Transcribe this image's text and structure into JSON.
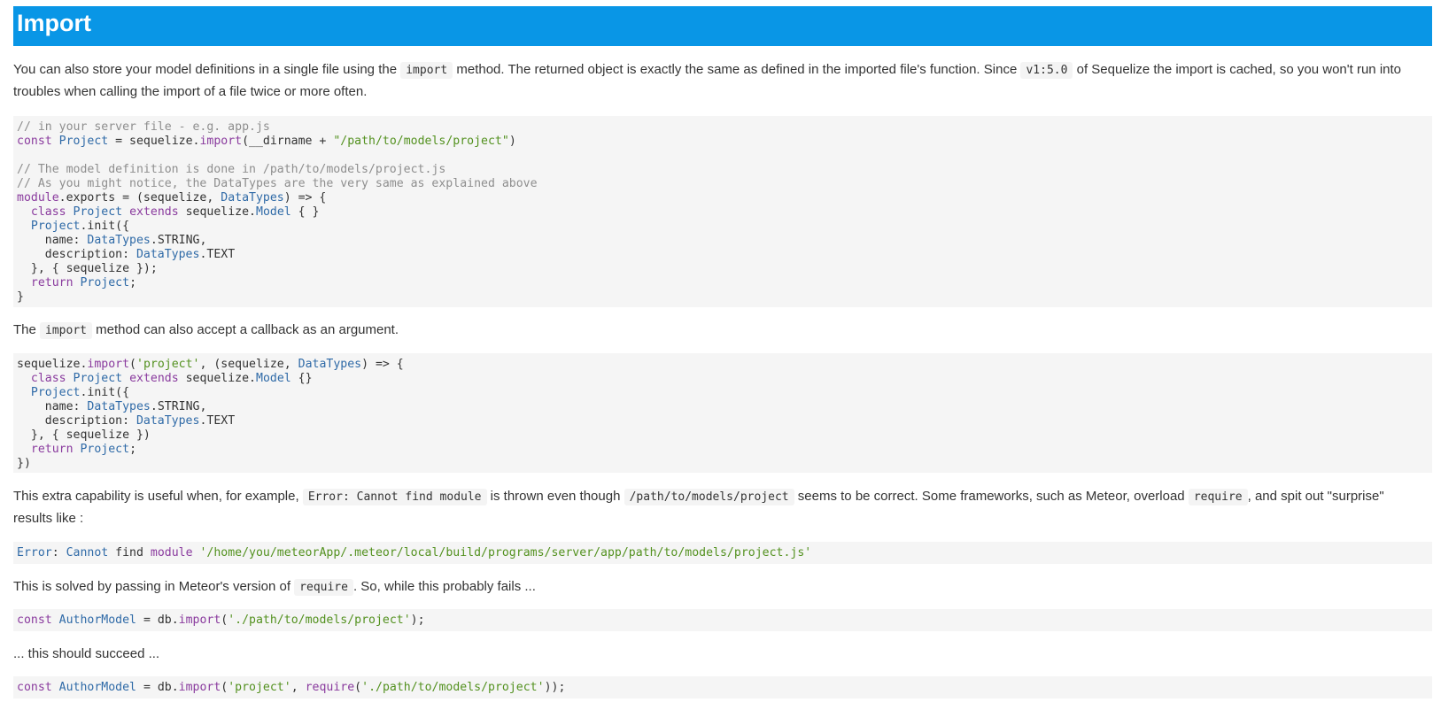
{
  "section": {
    "title": "Import"
  },
  "para1": {
    "t1": "You can also store your model definitions in a single file using the ",
    "c1": "import",
    "t2": " method. The returned object is exactly the same as defined in the imported file's function. Since ",
    "c2": "v1:5.0",
    "t3": " of Sequelize the import is cached, so you won't run into troubles when calling the import of a file twice or more often."
  },
  "code1": {
    "l1": "// in your server file - e.g. app.js",
    "l2_kw": "const",
    "l2_typ": "Project",
    "l2_mid": " = sequelize.",
    "l2_kw2": "import",
    "l2_mid2": "(__dirname + ",
    "l2_str": "\"/path/to/models/project\"",
    "l2_end": ")",
    "l4": "// The model definition is done in /path/to/models/project.js",
    "l5": "// As you might notice, the DataTypes are the very same as explained above",
    "l6_kw": "module",
    "l6_mid": ".exports = (sequelize, ",
    "l6_typ": "DataTypes",
    "l6_end": ") => {",
    "l7_kw": "class",
    "l7_typ": "Project",
    "l7_kw2": "extends",
    "l7_mid": " sequelize.",
    "l7_typ2": "Model",
    "l7_end": " { }",
    "l8_typ": "Project",
    "l8_end": ".init({",
    "l9_a": "name: ",
    "l9_typ": "DataTypes",
    "l9_end": ".STRING,",
    "l10_a": "description: ",
    "l10_typ": "DataTypes",
    "l10_end": ".TEXT",
    "l11": "}, { sequelize });",
    "l12_kw": "return",
    "l12_typ": "Project",
    "l12_end": ";",
    "l13": "}"
  },
  "para2": {
    "t1": "The ",
    "c1": "import",
    "t2": " method can also accept a callback as an argument."
  },
  "code2": {
    "l1_a": "sequelize.",
    "l1_kw": "import",
    "l1_b": "(",
    "l1_str": "'project'",
    "l1_c": ", (sequelize, ",
    "l1_typ": "DataTypes",
    "l1_end": ") => {",
    "l2_kw": "class",
    "l2_typ": "Project",
    "l2_kw2": "extends",
    "l2_mid": " sequelize.",
    "l2_typ2": "Model",
    "l2_end": " {}",
    "l3_typ": "Project",
    "l3_end": ".init({",
    "l4_a": "name: ",
    "l4_typ": "DataTypes",
    "l4_end": ".STRING,",
    "l5_a": "description: ",
    "l5_typ": "DataTypes",
    "l5_end": ".TEXT",
    "l6": "}, { sequelize })",
    "l7_kw": "return",
    "l7_typ": "Project",
    "l7_end": ";",
    "l8": "})"
  },
  "para3": {
    "t1": "This extra capability is useful when, for example, ",
    "c1": "Error: Cannot find module",
    "t2": " is thrown even though ",
    "c2": "/path/to/models/project",
    "t3": " seems to be correct. Some frameworks, such as Meteor, overload ",
    "c3": "require",
    "t4": ", and spit out \"surprise\" results like :"
  },
  "code3": {
    "typ": "Error",
    "a": ": ",
    "typ2": "Cannot",
    "b": " find ",
    "kw": "module",
    "c": " ",
    "str": "'/home/you/meteorApp/.meteor/local/build/programs/server/app/path/to/models/project.js'"
  },
  "para4": {
    "t1": "This is solved by passing in Meteor's version of ",
    "c1": "require",
    "t2": ". So, while this probably fails ..."
  },
  "code4": {
    "kw": "const",
    "typ": "AuthorModel",
    "a": " = db.",
    "kw2": "import",
    "b": "(",
    "str": "'./path/to/models/project'",
    "end": ");"
  },
  "para5": {
    "t1": "... this should succeed ..."
  },
  "code5": {
    "kw": "const",
    "typ": "AuthorModel",
    "a": " = db.",
    "kw2": "import",
    "b": "(",
    "str": "'project'",
    "c": ", ",
    "kw3": "require",
    "d": "(",
    "str2": "'./path/to/models/project'",
    "end": "));"
  },
  "colors": {
    "header_bg": "#0996e6",
    "code_bg": "#f5f5f5",
    "comment": "#8e8e8e",
    "keyword": "#8a3b9e",
    "type": "#2f6aa7",
    "string": "#53911f"
  }
}
